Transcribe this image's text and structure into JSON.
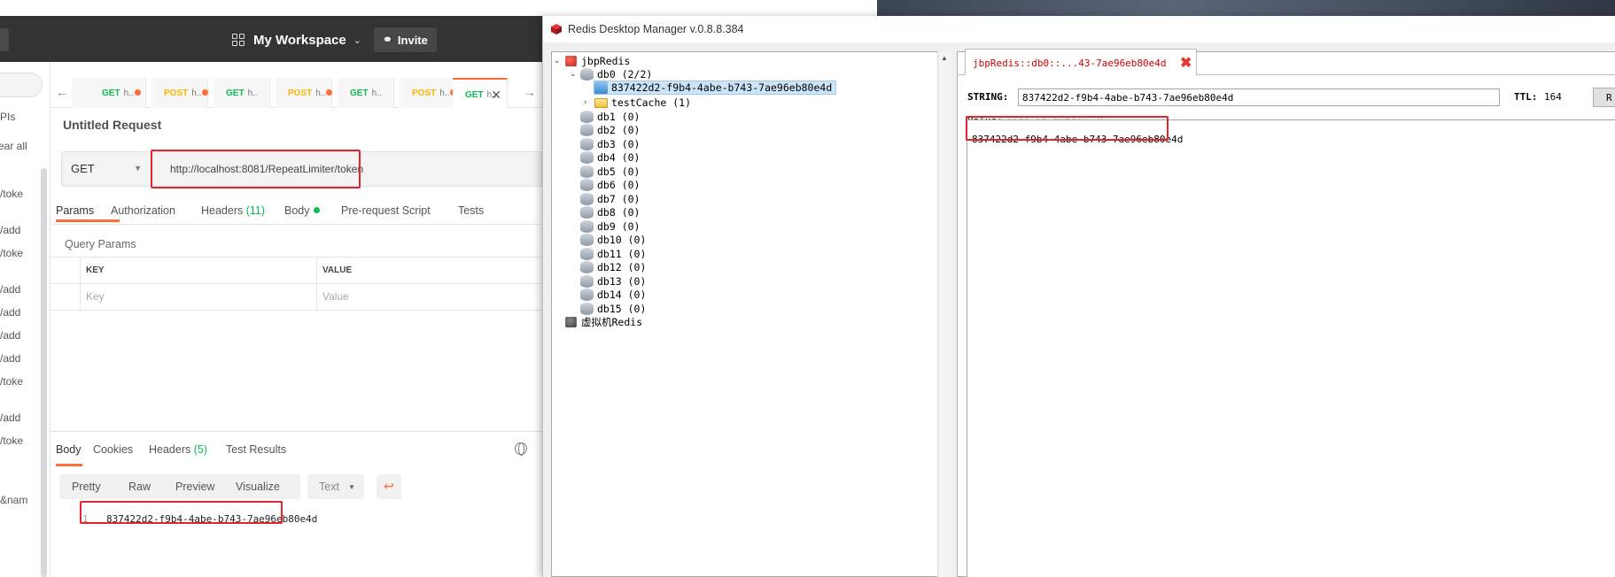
{
  "postman": {
    "workspace_label": "My Workspace",
    "invite_label": "Invite",
    "sidebar": {
      "items": [
        "PIs",
        "ear all",
        "/toke",
        "/add",
        "/toke",
        "/add",
        "/add",
        "/add",
        "/add",
        "/toke",
        "/add",
        "/toke",
        "&nam"
      ]
    },
    "tabs": [
      {
        "method": "GET",
        "name": "h..",
        "dirty": true
      },
      {
        "method": "POST",
        "name": "h..",
        "dirty": true
      },
      {
        "method": "GET",
        "name": "h..",
        "dirty": false
      },
      {
        "method": "POST",
        "name": "h..",
        "dirty": true
      },
      {
        "method": "GET",
        "name": "h..",
        "dirty": false
      },
      {
        "method": "POST",
        "name": "h..",
        "dirty": true
      },
      {
        "method": "GET",
        "name": "h..",
        "dirty": false
      }
    ],
    "request_title": "Untitled Request",
    "method": "GET",
    "url": "http://localhost:8081/RepeatLimiter/token",
    "request_tabs": {
      "params": "Params",
      "authorization": "Authorization",
      "headers": "Headers",
      "headers_count": "(11)",
      "body": "Body",
      "prerequest": "Pre-request Script",
      "tests": "Tests"
    },
    "query_params_label": "Query Params",
    "table": {
      "key_header": "KEY",
      "value_header": "VALUE",
      "key_placeholder": "Key",
      "value_placeholder": "Value"
    },
    "response_tabs": {
      "body": "Body",
      "cookies": "Cookies",
      "headers": "Headers",
      "headers_count": "(5)",
      "test_results": "Test Results"
    },
    "format_options": [
      "Pretty",
      "Raw",
      "Preview",
      "Visualize"
    ],
    "text_select": "Text",
    "response_line_number": "1",
    "response_body": "837422d2-f9b4-4abe-b743-7ae96eb80e4d"
  },
  "rdm": {
    "window_title": "Redis Desktop Manager v.0.8.8.384",
    "tree": {
      "server": "jbpRedis",
      "db0": "db0  (2/2)",
      "selected_key": "837422d2-f9b4-4abe-b743-7ae96eb80e4d",
      "folder": "testCache (1)",
      "databases": [
        "db1 (0)",
        "db2 (0)",
        "db3 (0)",
        "db4 (0)",
        "db5 (0)",
        "db6 (0)",
        "db7 (0)",
        "db8 (0)",
        "db9 (0)",
        "db10 (0)",
        "db11 (0)",
        "db12 (0)",
        "db13 (0)",
        "db14 (0)",
        "db15 (0)"
      ],
      "server2": "虚拟机Redis"
    },
    "detail": {
      "tab_title": "jbpRedis::db0::...43-7ae96eb80e4d",
      "key_type": "STRING:",
      "key_name": "837422d2-f9b4-4abe-b743-7ae96eb80e4d",
      "ttl_label": "TTL:",
      "ttl_value": "164",
      "rename_label": "R",
      "value_label": "Value:",
      "value_size": "size in bytes: 36",
      "value": "837422d2-f9b4-4abe-b743-7ae96eb80e4d"
    }
  },
  "colors": {
    "postman_orange": "#ff6c37",
    "get_green": "#0cbb52",
    "post_yellow": "#ffb400",
    "highlight_red": "#e4242c",
    "rdm_tab_red": "#d00000"
  }
}
